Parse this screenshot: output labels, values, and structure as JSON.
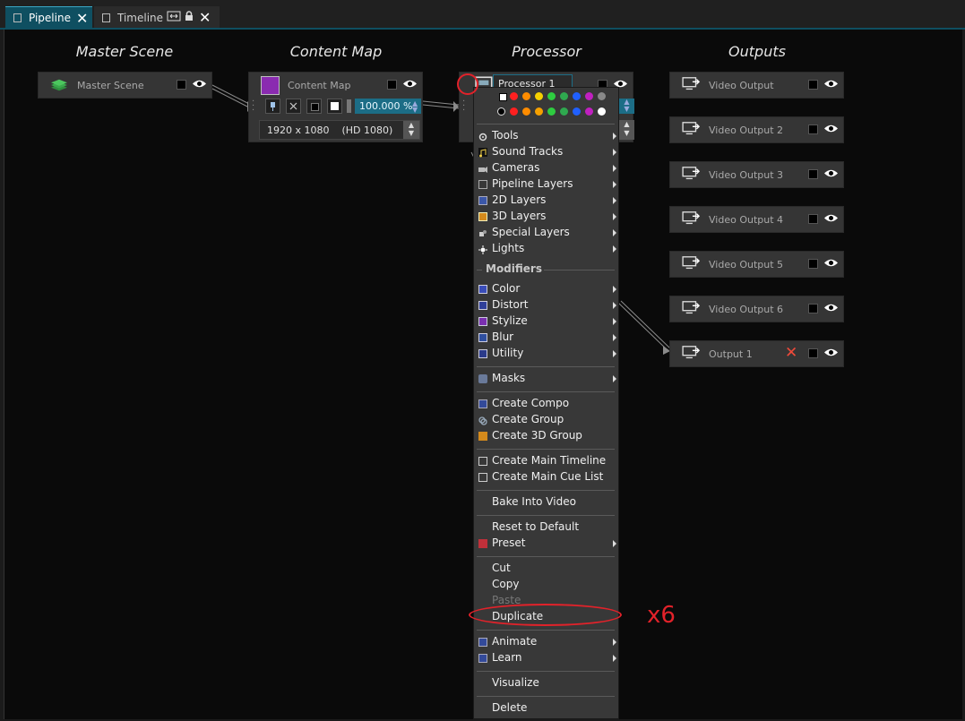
{
  "tabs": [
    {
      "label": "Pipeline",
      "close": "✕"
    },
    {
      "label": "Timeline",
      "close": "✕"
    }
  ],
  "columns": {
    "master_scene": "Master Scene",
    "content_map": "Content Map",
    "processor": "Processor",
    "outputs": "Outputs"
  },
  "master_node": {
    "title": "Master Scene"
  },
  "content_map_node": {
    "title": "Content Map",
    "percent": "100.000 %",
    "resolution": "1920 x 1080    (HD 1080)",
    "swatch_color": "#8a2bb0"
  },
  "processor_node": {
    "title": "Processor 1"
  },
  "outputs": [
    {
      "title": "Video Output"
    },
    {
      "title": "Video Output 2"
    },
    {
      "title": "Video Output 3"
    },
    {
      "title": "Video Output 4"
    },
    {
      "title": "Video Output 5"
    },
    {
      "title": "Video Output 6"
    },
    {
      "title": "Output 1"
    }
  ],
  "menu": {
    "colors_row1": [
      "#ff2020",
      "#ff8c00",
      "#f5d000",
      "#2ecc40",
      "#2fa84f",
      "#2060ff",
      "#c020c0",
      "#888888"
    ],
    "colors_row2": [
      "#ff2020",
      "#ff8c00",
      "#f5a000",
      "#2ecc40",
      "#2fa84f",
      "#2060ff",
      "#c020c0",
      "#ffffff"
    ],
    "tools": "Tools",
    "sound_tracks": "Sound Tracks",
    "cameras": "Cameras",
    "pipeline_layers": "Pipeline Layers",
    "layers_2d": "2D Layers",
    "layers_3d": "3D Layers",
    "special_layers": "Special Layers",
    "lights": "Lights",
    "modifiers_header": "Modifiers",
    "color": "Color",
    "distort": "Distort",
    "stylize": "Stylize",
    "blur": "Blur",
    "utility": "Utility",
    "masks": "Masks",
    "create_compo": "Create Compo",
    "create_group": "Create Group",
    "create_3d_group": "Create 3D Group",
    "create_main_timeline": "Create Main Timeline",
    "create_main_cue_list": "Create Main Cue List",
    "bake_into_video": "Bake Into Video",
    "reset_to_default": "Reset to Default",
    "preset": "Preset",
    "cut": "Cut",
    "copy": "Copy",
    "paste": "Paste",
    "duplicate": "Duplicate",
    "animate": "Animate",
    "learn": "Learn",
    "visualize": "Visualize",
    "delete": "Delete"
  },
  "annotation": "x6",
  "accent": "#0f4f61",
  "annotation_color": "#e2222a"
}
